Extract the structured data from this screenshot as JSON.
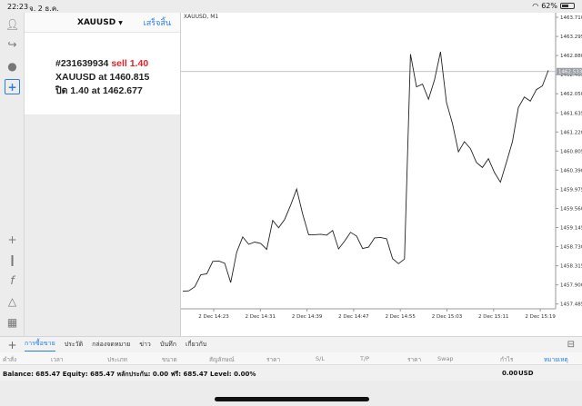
{
  "status": {
    "time": "22:23",
    "date": "จ. 2 ธ.ค.",
    "battery": "62%",
    "battery_level": 0.62
  },
  "order_panel": {
    "symbol": "XAUUSD",
    "done_label": "เสร็จสิ้น",
    "ticket": "#231639934",
    "side_volume": "sell 1.40",
    "open_line": "XAUUSD at 1460.815",
    "close_line": "ปิด 1.40 at 1462.677"
  },
  "chart_label": "XAUUSD, M1",
  "chart_data": {
    "type": "line",
    "title": "XAUUSD, M1",
    "x_ticks": [
      "2 Dec 14:23",
      "2 Dec 14:31",
      "2 Dec 14:39",
      "2 Dec 14:47",
      "2 Dec 14:55",
      "2 Dec 15:03",
      "2 Dec 15:11",
      "2 Dec 15:19"
    ],
    "y_ticks": [
      "1463.710",
      "1463.295",
      "1462.880",
      "1462.465",
      "1462.050",
      "1461.635",
      "1461.220",
      "1460.805",
      "1460.390",
      "1459.975",
      "1459.560",
      "1459.145",
      "1458.730",
      "1458.315",
      "1457.900",
      "1457.485"
    ],
    "ylim": [
      1457.38,
      1463.81
    ],
    "current_price": "1462.533",
    "current_price_value": 1462.533,
    "series": [
      {
        "values": [
          1457.76,
          1457.77,
          1457.86,
          1458.12,
          1458.14,
          1458.41,
          1458.42,
          1458.37,
          1457.95,
          1458.61,
          1458.94,
          1458.78,
          1458.83,
          1458.8,
          1458.67,
          1459.3,
          1459.14,
          1459.32,
          1459.63,
          1459.98,
          1459.44,
          1458.99,
          1458.99,
          1459.0,
          1458.98,
          1459.08,
          1458.68,
          1458.85,
          1459.04,
          1458.96,
          1458.69,
          1458.72,
          1458.92,
          1458.93,
          1458.9,
          1458.47,
          1458.36,
          1458.46,
          1462.91,
          1462.2,
          1462.26,
          1461.93,
          1462.35,
          1462.96,
          1461.86,
          1461.4,
          1460.79,
          1461.01,
          1460.86,
          1460.56,
          1460.45,
          1460.64,
          1460.34,
          1460.13,
          1460.56,
          1461.01,
          1461.75,
          1461.98,
          1461.89,
          1462.14,
          1462.22,
          1462.56
        ]
      }
    ]
  },
  "bottom_tabs": [
    "การซื้อขาย",
    "ประวัติ",
    "กล่องจดหมาย",
    "ข่าว",
    "บันทึก",
    "เกี่ยวกับ"
  ],
  "columns": [
    "คำสั่ง",
    "เวลา",
    "ประเภท",
    "ขนาด",
    "สัญลักษณ์",
    "ราคา",
    "S/L",
    "T/P",
    "ราคา",
    "Swap",
    "กำไร",
    "หมายเหตุ"
  ],
  "balance_text": "Balance: 685.47 Equity: 685.47 หลักประกัน: 0.00 ฟรี: 685.47 Level: 0.00%",
  "balance_value": "0.00",
  "currency": "USD",
  "colors": {
    "accent": "#2a7ee0",
    "sell": "#e0242a"
  },
  "icons": [
    "person-icon",
    "share-icon",
    "chat-icon",
    "add-order-icon",
    "crosshair-icon",
    "candlestick-icon",
    "indicator-f-icon",
    "objects-icon",
    "layout-icon"
  ]
}
